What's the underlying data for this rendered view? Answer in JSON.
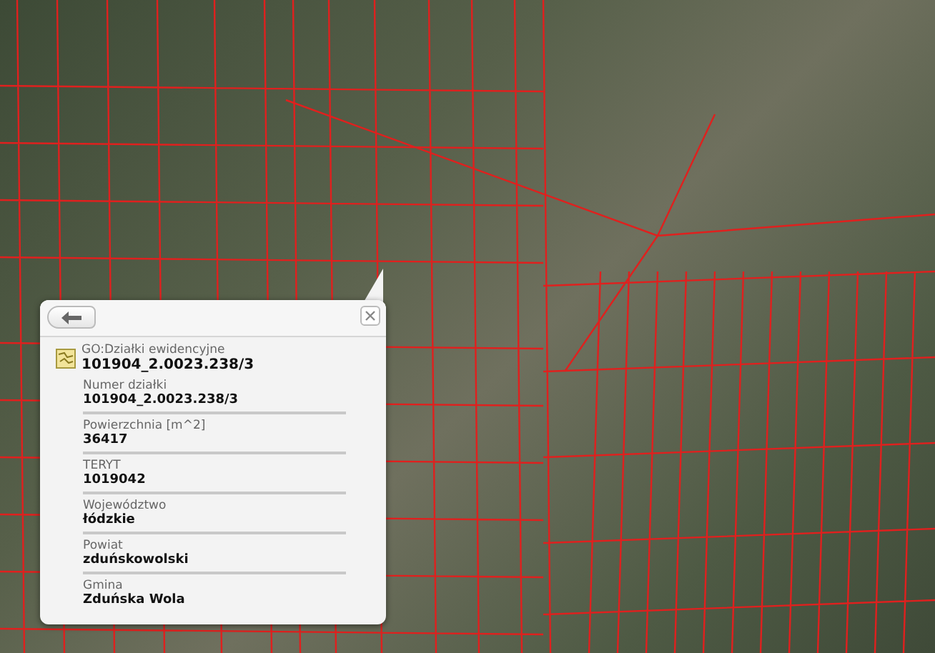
{
  "map": {
    "popup": {
      "layer": "GO:Działki ewidencyjne",
      "title": "101904_2.0023.238/3",
      "fields": [
        {
          "label": "Numer działki",
          "value": "101904_2.0023.238/3"
        },
        {
          "label": "Powierzchnia [m^2]",
          "value": "36417"
        },
        {
          "label": "TERYT",
          "value": "1019042"
        },
        {
          "label": "Województwo",
          "value": "łódzkie"
        },
        {
          "label": "Powiat",
          "value": "zduńskowolski"
        },
        {
          "label": "Gmina",
          "value": "Zduńska Wola"
        }
      ]
    }
  }
}
